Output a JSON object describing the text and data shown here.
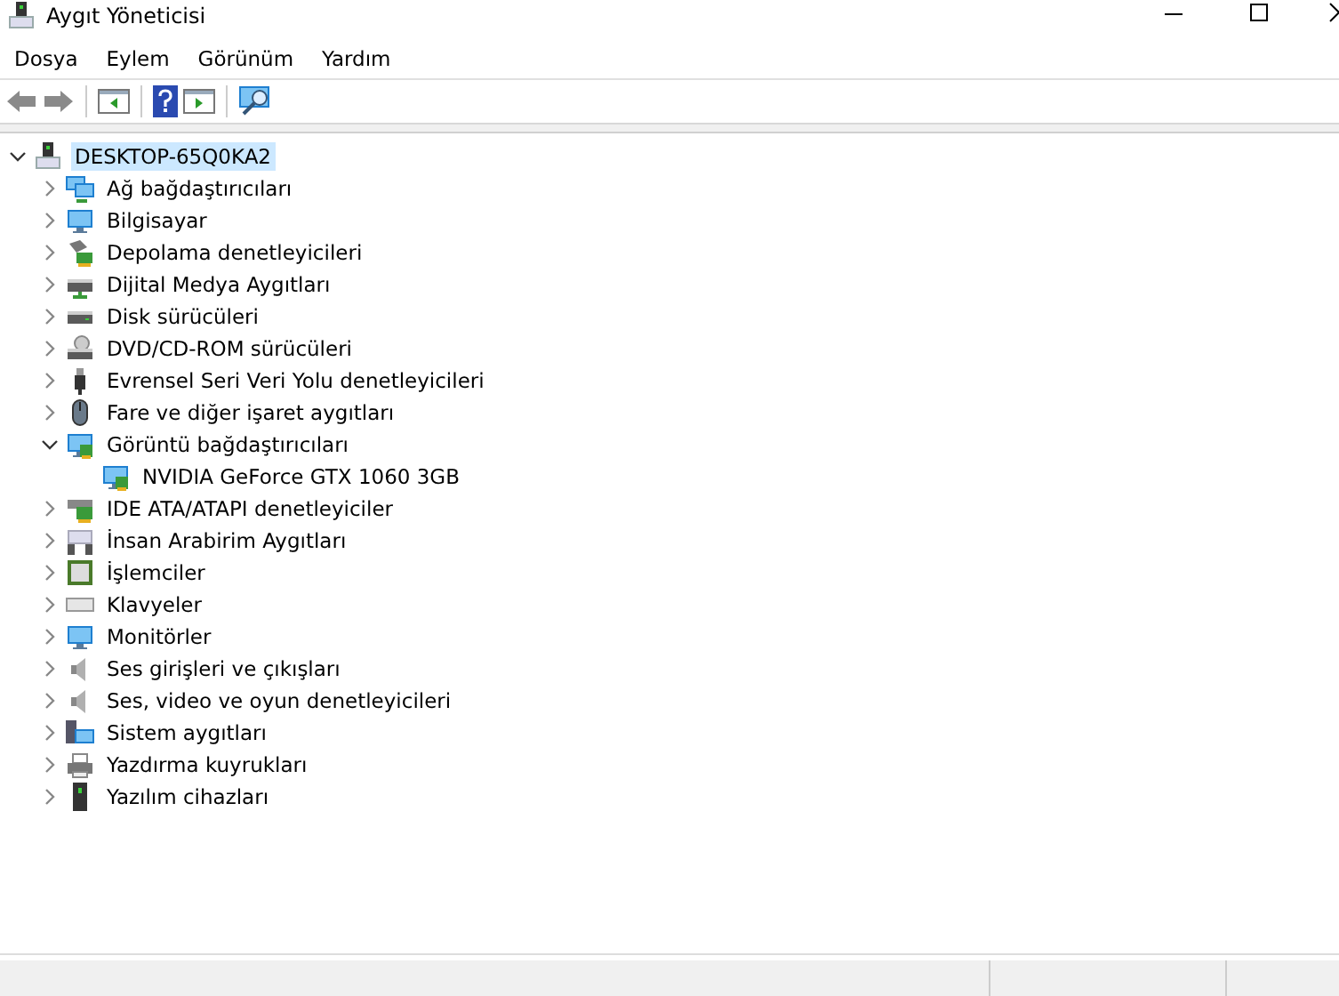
{
  "window": {
    "title": "Aygıt Yöneticisi"
  },
  "menu": [
    "Dosya",
    "Eylem",
    "Görünüm",
    "Yardım"
  ],
  "tree": [
    {
      "label": "DESKTOP-65Q0KA2",
      "selected": true,
      "expanded": true,
      "children": [
        {
          "label": "Ağ bağdaştırıcıları",
          "expanded": false
        },
        {
          "label": "Bilgisayar",
          "expanded": false
        },
        {
          "label": "Depolama denetleyicileri",
          "expanded": false
        },
        {
          "label": "Dijital Medya Aygıtları",
          "expanded": false
        },
        {
          "label": "Disk sürücüleri",
          "expanded": false
        },
        {
          "label": "DVD/CD-ROM sürücüleri",
          "expanded": false
        },
        {
          "label": "Evrensel Seri Veri Yolu denetleyicileri",
          "expanded": false
        },
        {
          "label": "Fare ve diğer işaret aygıtları",
          "expanded": false
        },
        {
          "label": "Görüntü bağdaştırıcıları",
          "expanded": true,
          "children": [
            {
              "label": "NVIDIA GeForce GTX 1060 3GB"
            }
          ]
        },
        {
          "label": "IDE ATA/ATAPI denetleyiciler",
          "expanded": false
        },
        {
          "label": "İnsan Arabirim Aygıtları",
          "expanded": false
        },
        {
          "label": "İşlemciler",
          "expanded": false
        },
        {
          "label": "Klavyeler",
          "expanded": false
        },
        {
          "label": "Monitörler",
          "expanded": false
        },
        {
          "label": "Ses girişleri ve çıkışları",
          "expanded": false
        },
        {
          "label": "Ses, video ve oyun denetleyicileri",
          "expanded": false
        },
        {
          "label": "Sistem aygıtları",
          "expanded": false
        },
        {
          "label": "Yazdırma kuyrukları",
          "expanded": false
        },
        {
          "label": "Yazılım cihazları",
          "expanded": false
        }
      ]
    }
  ]
}
